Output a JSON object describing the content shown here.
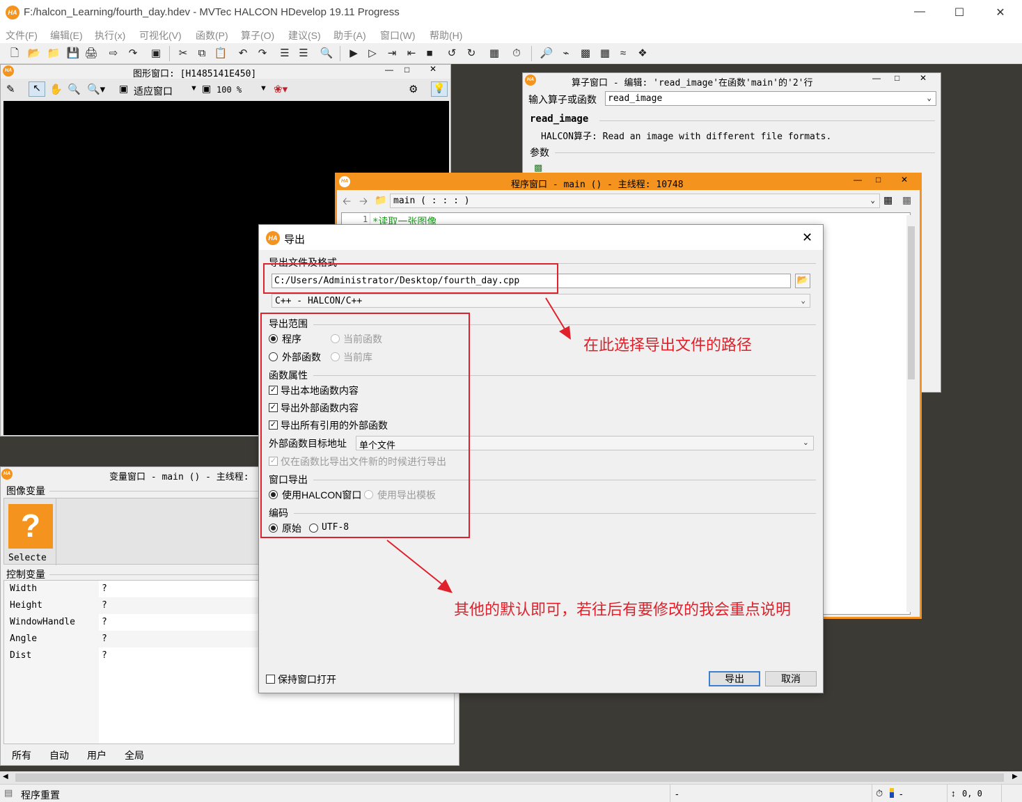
{
  "app": {
    "title": "F:/halcon_Learning/fourth_day.hdev - MVTec HALCON HDevelop 19.11 Progress",
    "logo_text": "HA"
  },
  "menu": [
    "文件(F)",
    "编辑(E)",
    "执行(x)",
    "可视化(V)",
    "函数(P)",
    "算子(O)",
    "建议(S)",
    "助手(A)",
    "窗口(W)",
    "帮助(H)"
  ],
  "graphics_window": {
    "title": "图形窗口: [H1485141E450]",
    "fit_label": "适应窗口",
    "zoom_value": "100 %"
  },
  "operator_window": {
    "title": "算子窗口 - 编辑: 'read_image'在函数'main'的'2'行",
    "input_label": "输入算子或函数",
    "input_value": "read_image",
    "op_name": "read_image",
    "op_desc": "HALCON算子: Read an image with different file formats.",
    "params_label": "参数"
  },
  "program_window": {
    "title": "程序窗口 - main () - 主线程: 10748",
    "proc_select": "main ( : : : )",
    "line_number": "1",
    "line_text": "*读取一张图像"
  },
  "variable_window": {
    "title": "变量窗口 - main () - 主线程:",
    "image_vars_label": "图像变量",
    "image_item_label": "Selecte",
    "control_vars_label": "控制变量",
    "control_vars": [
      {
        "name": "Width",
        "value": "?"
      },
      {
        "name": "Height",
        "value": "?"
      },
      {
        "name": "WindowHandle",
        "value": "?"
      },
      {
        "name": "Angle",
        "value": "?"
      },
      {
        "name": "Dist",
        "value": "?"
      }
    ],
    "tabs": [
      "所有",
      "自动",
      "用户",
      "全局"
    ]
  },
  "dialog": {
    "title": "导出",
    "file_group": "导出文件及格式",
    "file_path": "C:/Users/Administrator/Desktop/fourth_day.cpp",
    "format": "C++ - HALCON/C++",
    "range_group": "导出范围",
    "range_program": "程序",
    "range_current_func": "当前函数",
    "range_external_func": "外部函数",
    "range_current_lib": "当前库",
    "func_props_group": "函数属性",
    "chk_local": "导出本地函数内容",
    "chk_external": "导出外部函数内容",
    "chk_all_ref": "导出所有引用的外部函数",
    "ext_target_label": "外部函数目标地址",
    "ext_target_value": "单个文件",
    "chk_only_newer": "仅在函数比导出文件新的时候进行导出",
    "window_export_group": "窗口导出",
    "use_halcon_window": "使用HALCON窗口",
    "use_export_template": "使用导出模板",
    "encoding_group": "编码",
    "enc_original": "原始",
    "enc_utf8": "UTF-8",
    "keep_open": "保持窗口打开",
    "export_btn": "导出",
    "cancel_btn": "取消"
  },
  "annotations": {
    "path_note": "在此选择导出文件的路径",
    "default_note": "其他的默认即可，若往后有要修改的我会重点说明",
    "color": "#e0202a"
  },
  "status": {
    "message": "程序重置",
    "dash1": "-",
    "dash2": "-",
    "coords": "0, 0"
  }
}
